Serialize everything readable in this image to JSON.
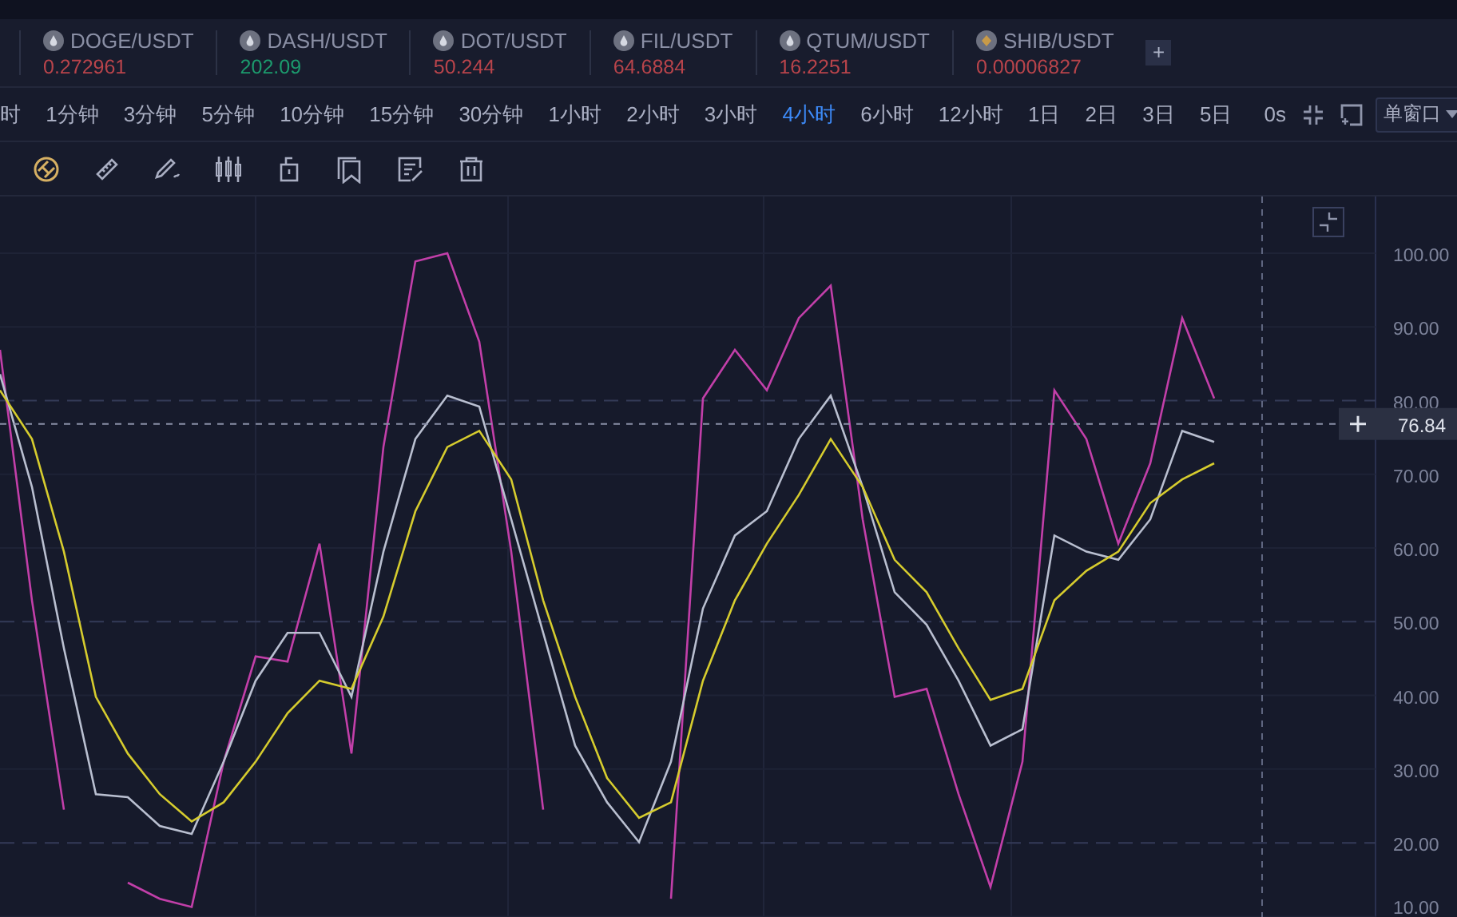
{
  "tickers": [
    {
      "symbol": "DOGE/USDT",
      "price": "0.272961",
      "up": false,
      "kind": "drop"
    },
    {
      "symbol": "DASH/USDT",
      "price": "202.09",
      "up": true,
      "kind": "drop"
    },
    {
      "symbol": "DOT/USDT",
      "price": "50.244",
      "up": false,
      "kind": "drop"
    },
    {
      "symbol": "FIL/USDT",
      "price": "64.6884",
      "up": false,
      "kind": "drop"
    },
    {
      "symbol": "QTUM/USDT",
      "price": "16.2251",
      "up": false,
      "kind": "drop"
    },
    {
      "symbol": "SHIB/USDT",
      "price": "0.00006827",
      "up": false,
      "kind": "diamond"
    }
  ],
  "add_ticker": "+",
  "intervals": [
    {
      "label": "时",
      "selected": false
    },
    {
      "label": "1分钟",
      "selected": false
    },
    {
      "label": "3分钟",
      "selected": false
    },
    {
      "label": "5分钟",
      "selected": false
    },
    {
      "label": "10分钟",
      "selected": false
    },
    {
      "label": "15分钟",
      "selected": false
    },
    {
      "label": "30分钟",
      "selected": false
    },
    {
      "label": "1小时",
      "selected": false
    },
    {
      "label": "2小时",
      "selected": false
    },
    {
      "label": "3小时",
      "selected": false
    },
    {
      "label": "4小时",
      "selected": true
    },
    {
      "label": "6小时",
      "selected": false
    },
    {
      "label": "12小时",
      "selected": false
    },
    {
      "label": "1日",
      "selected": false
    },
    {
      "label": "2日",
      "selected": false
    },
    {
      "label": "3日",
      "selected": false
    },
    {
      "label": "5日",
      "selected": false
    }
  ],
  "countdown": "0s",
  "window_mode": "单窗口",
  "tools": [
    {
      "kind": "magnet"
    },
    {
      "kind": "ruler"
    },
    {
      "kind": "pen"
    },
    {
      "kind": "candles"
    },
    {
      "kind": "lock"
    },
    {
      "kind": "bookmark"
    },
    {
      "kind": "note"
    },
    {
      "kind": "trash"
    }
  ],
  "crosshair": {
    "label": "76.84"
  },
  "chart_data": {
    "type": "line",
    "grid": true,
    "ylim": [
      9.5,
      107.7
    ],
    "yticks": [
      {
        "value": 10,
        "label": "10.00"
      },
      {
        "value": 20,
        "label": "20.00"
      },
      {
        "value": 30,
        "label": "30.00"
      },
      {
        "value": 40,
        "label": "40.00"
      },
      {
        "value": 50,
        "label": "50.00"
      },
      {
        "value": 60,
        "label": "60.00"
      },
      {
        "value": 70,
        "label": "70.00"
      },
      {
        "value": 80,
        "label": "80.00"
      },
      {
        "value": 90,
        "label": "90.00"
      },
      {
        "value": 100,
        "label": "100.00"
      }
    ],
    "series": [
      {
        "color": "#c23fa9",
        "values": [
          86.9,
          52.9,
          24.5,
          null,
          14.6,
          12.4,
          11.3,
          31,
          45.3,
          44.6,
          60.6,
          32.1,
          73.7,
          98.9,
          100,
          88,
          59.5,
          24.5,
          null,
          null,
          null,
          12.4,
          80.3,
          86.9,
          81.4,
          91.2,
          95.6,
          63.9,
          39.8,
          40.9,
          26.6,
          14,
          31,
          81.4,
          74.8,
          60.6,
          71.5,
          91.2,
          80.3
        ]
      },
      {
        "color": "#b9bfd0",
        "values": [
          83.6,
          68.3,
          46.4,
          26.6,
          26.2,
          22.3,
          21.2,
          31,
          42,
          48.5,
          48.5,
          39.8,
          59.5,
          74.8,
          80.7,
          79.2,
          63.9,
          48.5,
          33.2,
          25.5,
          20.1,
          31,
          51.8,
          61.7,
          65,
          74.8,
          80.7,
          68.3,
          54,
          49.6,
          42,
          33.2,
          35.4,
          61.7,
          59.5,
          58.4,
          63.9,
          75.9,
          74.4
        ]
      },
      {
        "color": "#d6cc2e",
        "values": [
          81.4,
          74.8,
          59.5,
          39.8,
          32.1,
          26.6,
          22.9,
          25.5,
          31,
          37.6,
          42,
          40.9,
          50.7,
          65,
          73.7,
          75.9,
          69.3,
          52.9,
          39.8,
          28.8,
          23.4,
          25.5,
          42,
          52.9,
          60.6,
          67.2,
          74.8,
          68.3,
          58.4,
          54,
          46.4,
          39.4,
          40.9,
          52.9,
          56.9,
          59.5,
          66.1,
          69.3,
          71.5
        ]
      }
    ]
  }
}
